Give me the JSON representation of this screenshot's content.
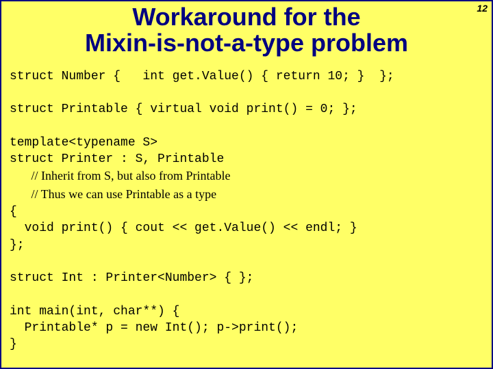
{
  "pagenum": "12",
  "title": {
    "line1": "Workaround for the",
    "line2": "Mixin-is-not-a-type problem"
  },
  "code": {
    "l1": "struct Number {   int get.Value() { return 10; }  };",
    "l2": "",
    "l3": "struct Printable { virtual void print() = 0; };",
    "l4": "",
    "l5": "template<typename S>",
    "l6": "struct Printer : S, Printable",
    "c1": "       // Inherit from S, but also from Printable",
    "c2": "       // Thus we can use Printable as a type",
    "l7": "{",
    "l8": "  void print() { cout << get.Value() << endl; }",
    "l9": "};",
    "l10": "",
    "l11": "struct Int : Printer<Number> { };",
    "l12": "",
    "l13": "int main(int, char**) {",
    "l14": "  Printable* p = new Int(); p->print();",
    "l15": "}"
  }
}
